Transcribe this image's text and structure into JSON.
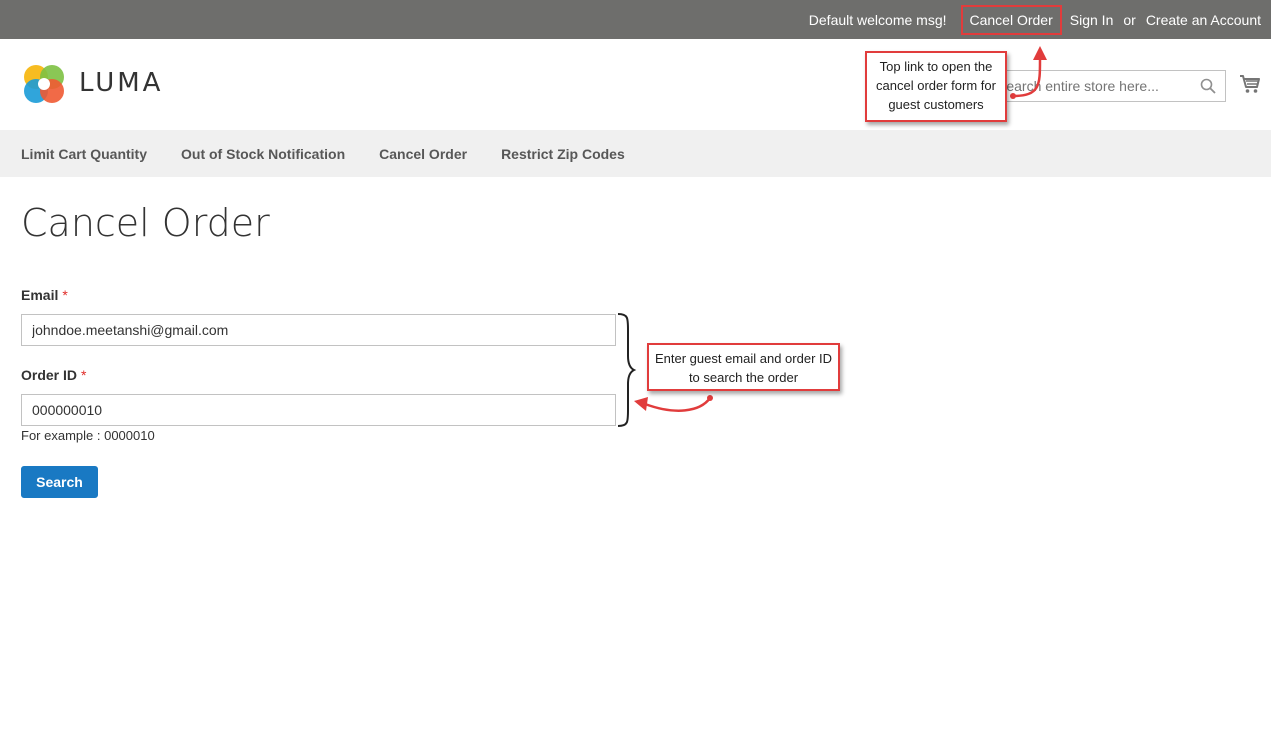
{
  "top_links": {
    "welcome": "Default welcome msg!",
    "cancel_order": "Cancel Order",
    "sign_in": "Sign In",
    "or": "or",
    "create_account": "Create an Account"
  },
  "header": {
    "logo_text": "LUMA",
    "search_placeholder": "Search entire store here...",
    "search_icon": "magnifier-icon",
    "cart_icon": "cart-icon"
  },
  "nav": {
    "items": [
      {
        "label": "Limit Cart Quantity"
      },
      {
        "label": "Out of Stock Notification"
      },
      {
        "label": "Cancel Order"
      },
      {
        "label": "Restrict Zip Codes"
      }
    ]
  },
  "main": {
    "title": "Cancel Order",
    "email": {
      "label": "Email",
      "required_mark": "*",
      "value": "johndoe.meetanshi@gmail.com"
    },
    "order_id": {
      "label": "Order ID",
      "required_mark": "*",
      "value": "000000010",
      "note": "For example : 0000010"
    },
    "search_button": "Search"
  },
  "annotations": {
    "top_link_note": "Top link to open the cancel order form for guest customers",
    "form_note": "Enter guest email and order ID to search the order"
  },
  "colors": {
    "topbar": "#6e6e6c",
    "nav": "#f0f0f0",
    "button": "#1979c3",
    "annotation": "#e13c3c",
    "required": "#e02b27"
  }
}
